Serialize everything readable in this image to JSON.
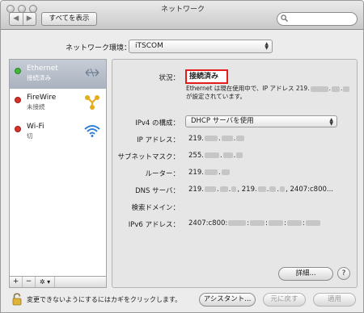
{
  "window": {
    "title": "ネットワーク"
  },
  "toolbar": {
    "back": "◀",
    "forward": "▶",
    "show_all": "すべてを表示",
    "search_placeholder": ""
  },
  "location": {
    "label": "ネットワーク環境：",
    "value": "iTSCOM"
  },
  "services": [
    {
      "name": "Ethernet",
      "status": "接続済み",
      "status_color": "#3fb53b",
      "icon": "ethernet-arrows-icon"
    },
    {
      "name": "FireWire",
      "status": "未接続",
      "status_color": "#d8312a",
      "icon": "firewire-icon"
    },
    {
      "name": "Wi-Fi",
      "status": "切",
      "status_color": "#d8312a",
      "icon": "wifi-icon"
    }
  ],
  "sidebar_tools": {
    "add": "+",
    "remove": "−",
    "action": "✲ ▾"
  },
  "detail": {
    "status_label": "状況：",
    "status_value": "接続済み",
    "status_note": "Ethernet は現在使用中で、IP アドレス 219.",
    "status_note_tail": "が設定されています。",
    "ipv4_label": "IPv4 の構成：",
    "ipv4_value": "DHCP サーバを使用",
    "ip_label": "IP アドレス：",
    "ip_value": "219.",
    "subnet_label": "サブネットマスク：",
    "subnet_value": "255.",
    "router_label": "ルーター：",
    "router_value": "219.",
    "dns_label": "DNS サーバ：",
    "dns_value_a": "219.",
    "dns_value_b": "219.",
    "dns_value_c": "2407:c800...",
    "search_domain_label": "検索ドメイン：",
    "ipv6_label": "IPv6 アドレス：",
    "ipv6_value": "2407:c800:",
    "advanced_button": "詳細...",
    "help": "?"
  },
  "footer": {
    "lock_text": "変更できないようにするにはカギをクリックします。",
    "assistant_button": "アシスタント...",
    "revert_button": "元に戻す",
    "apply_button": "適用"
  },
  "colors": {
    "highlight_box": "#e41c1c",
    "selected_row": "#b4bcc8"
  }
}
